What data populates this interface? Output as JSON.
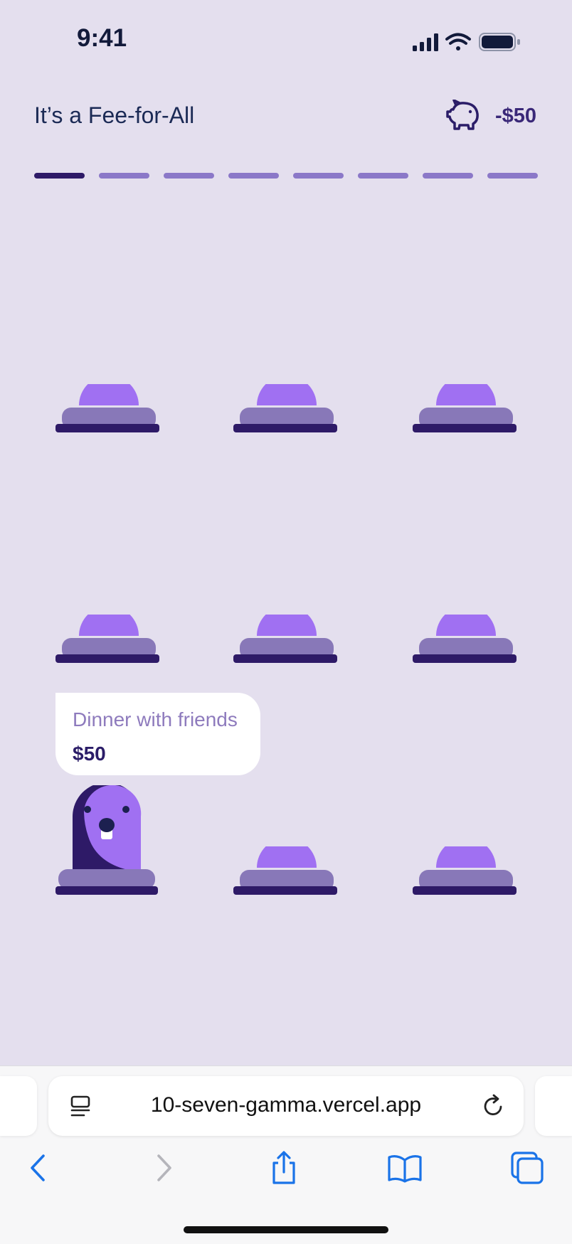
{
  "status_bar": {
    "time": "9:41"
  },
  "header": {
    "title": "It’s a Fee-for-All",
    "balance": "-$50",
    "icon": "piggy-bank-icon"
  },
  "progress": {
    "total_steps": 8,
    "current_step": 1
  },
  "game": {
    "holes": 9,
    "popup": {
      "label": "Dinner with friends",
      "amount": "$50",
      "hole": 7
    }
  },
  "browser": {
    "url": "10-seven-gamma.vercel.app",
    "icons": [
      "reader-icon",
      "reload-icon",
      "back-icon",
      "forward-icon",
      "share-icon",
      "bookmarks-icon",
      "tabs-icon"
    ]
  },
  "colors": {
    "background": "#e4dfee",
    "accent": "#a070f2",
    "dark_purple": "#2e1a67",
    "mid_purple": "#8b78c8"
  }
}
